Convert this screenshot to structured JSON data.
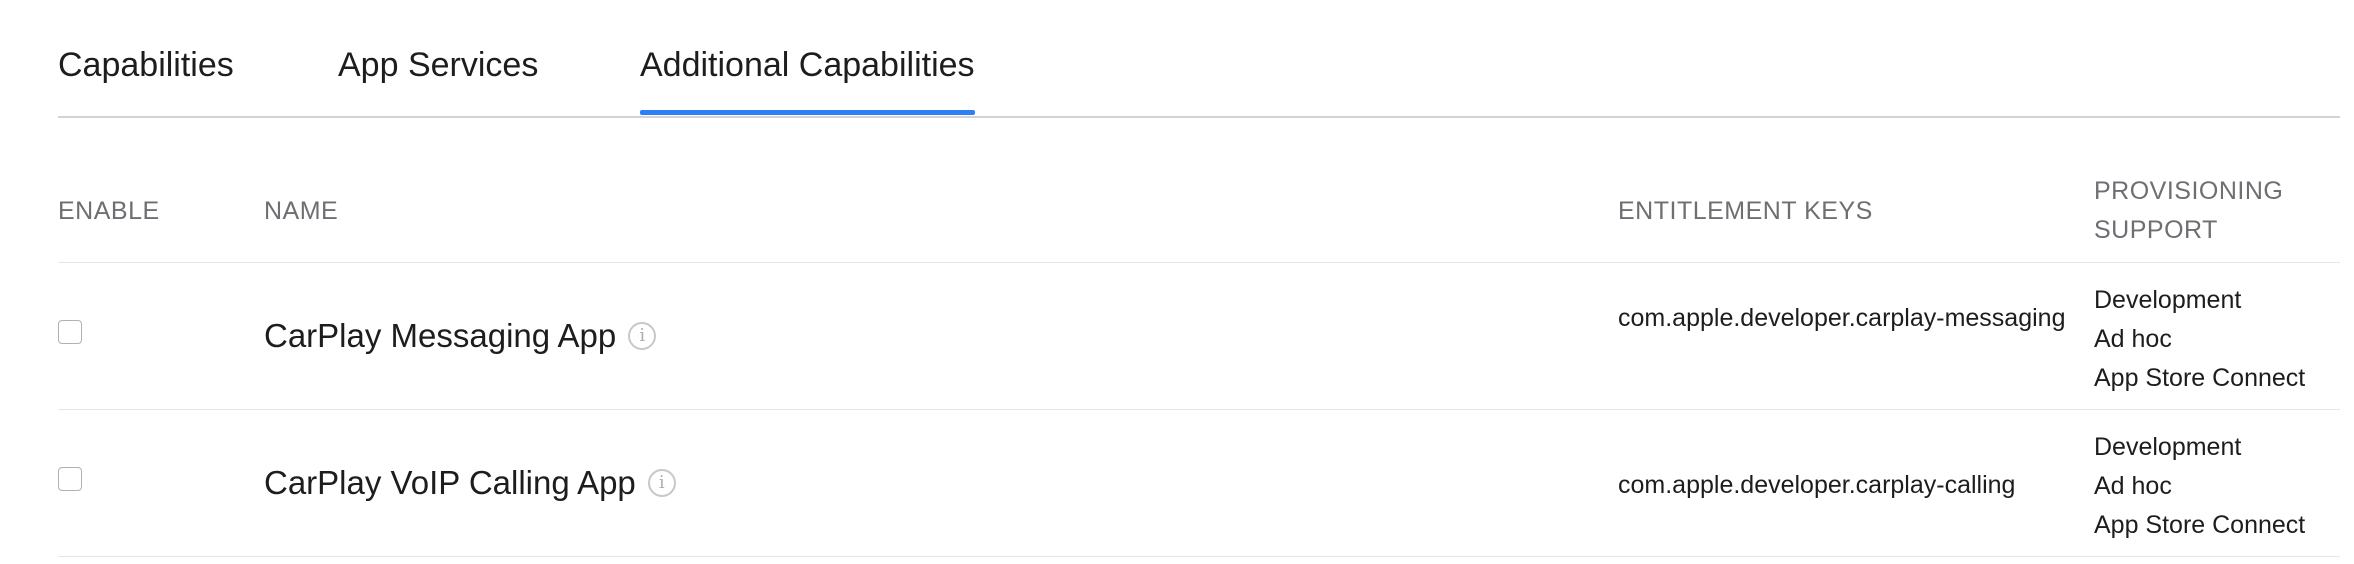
{
  "tabs": [
    {
      "label": "Capabilities"
    },
    {
      "label": "App Services"
    },
    {
      "label": "Additional Capabilities"
    }
  ],
  "active_tab": "Additional Capabilities",
  "columns": {
    "enable": "ENABLE",
    "name": "NAME",
    "entitlement_keys": "ENTITLEMENT KEYS",
    "provisioning_support": "PROVISIONING SUPPORT"
  },
  "rows": [
    {
      "enabled": false,
      "name": "CarPlay Messaging App",
      "key": "com.apple.developer.carplay-messaging",
      "provisioning": [
        "Development",
        "Ad hoc",
        "App Store Connect"
      ]
    },
    {
      "enabled": false,
      "name": "CarPlay VoIP Calling App",
      "key": "com.apple.developer.carplay-calling",
      "provisioning": [
        "Development",
        "Ad hoc",
        "App Store Connect"
      ]
    }
  ],
  "colors": {
    "accent": "#2d7ef7",
    "divider": "#e5e5ea",
    "header_text": "#6e6e73"
  }
}
